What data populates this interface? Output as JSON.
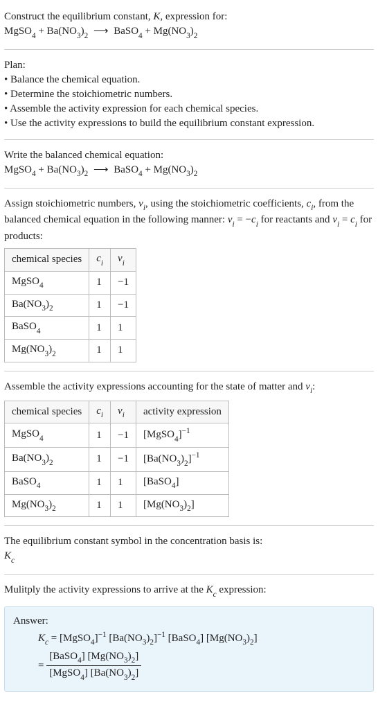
{
  "header": {
    "title_prefix": "Construct the equilibrium constant, ",
    "title_K": "K",
    "title_suffix": ", expression for:"
  },
  "equation": {
    "r1": "MgSO",
    "r1s": "4",
    "plus1": " + ",
    "r2": "Ba(NO",
    "r2s": "3",
    "r2e": ")",
    "r2s2": "2",
    "arrow": " ⟶ ",
    "p1": "BaSO",
    "p1s": "4",
    "plus2": " + ",
    "p2": "Mg(NO",
    "p2s": "3",
    "p2e": ")",
    "p2s2": "2"
  },
  "plan": {
    "heading": "Plan:",
    "b1": "• Balance the chemical equation.",
    "b2": "• Determine the stoichiometric numbers.",
    "b3": "• Assemble the activity expression for each chemical species.",
    "b4": "• Use the activity expressions to build the equilibrium constant expression."
  },
  "balanced_heading": "Write the balanced chemical equation:",
  "stoich": {
    "intro_a": "Assign stoichiometric numbers, ",
    "nu": "ν",
    "nu_i": "i",
    "intro_b": ", using the stoichiometric coefficients, ",
    "c": "c",
    "c_i": "i",
    "intro_c": ", from the balanced chemical equation in the following manner: ",
    "rel1": " = −",
    "intro_d": " for reactants and ",
    "rel2": " = ",
    "intro_e": " for products:",
    "th1": "chemical species",
    "th2": "c",
    "th2i": "i",
    "th3": "ν",
    "th3i": "i",
    "rows": [
      {
        "sp": "MgSO",
        "sps": "4",
        "sp2": "",
        "sps2": "",
        "c": "1",
        "v": "−1"
      },
      {
        "sp": "Ba(NO",
        "sps": "3",
        "sp2": ")",
        "sps2": "2",
        "c": "1",
        "v": "−1"
      },
      {
        "sp": "BaSO",
        "sps": "4",
        "sp2": "",
        "sps2": "",
        "c": "1",
        "v": "1"
      },
      {
        "sp": "Mg(NO",
        "sps": "3",
        "sp2": ")",
        "sps2": "2",
        "c": "1",
        "v": "1"
      }
    ]
  },
  "activity": {
    "heading_a": "Assemble the activity expressions accounting for the state of matter and ",
    "heading_b": ":",
    "th4": "activity expression",
    "rows": [
      {
        "sp": "MgSO",
        "sps": "4",
        "sp2": "",
        "sps2": "",
        "c": "1",
        "v": "−1",
        "act_pre": "[MgSO",
        "act_s": "4",
        "act_mid": "]",
        "act_s2": "",
        "act_exp": "−1"
      },
      {
        "sp": "Ba(NO",
        "sps": "3",
        "sp2": ")",
        "sps2": "2",
        "c": "1",
        "v": "−1",
        "act_pre": "[Ba(NO",
        "act_s": "3",
        "act_mid": ")",
        "act_s2": "2",
        "act_close": "]",
        "act_exp": "−1"
      },
      {
        "sp": "BaSO",
        "sps": "4",
        "sp2": "",
        "sps2": "",
        "c": "1",
        "v": "1",
        "act_pre": "[BaSO",
        "act_s": "4",
        "act_mid": "]",
        "act_s2": "",
        "act_exp": ""
      },
      {
        "sp": "Mg(NO",
        "sps": "3",
        "sp2": ")",
        "sps2": "2",
        "c": "1",
        "v": "1",
        "act_pre": "[Mg(NO",
        "act_s": "3",
        "act_mid": ")",
        "act_s2": "2",
        "act_close": "]",
        "act_exp": ""
      }
    ]
  },
  "symbol": {
    "line1": "The equilibrium constant symbol in the concentration basis is:",
    "Kc": "K",
    "Kc_sub": "c"
  },
  "multiply": {
    "line_a": "Mulitply the activity expressions to arrive at the ",
    "line_b": " expression:"
  },
  "answer": {
    "label": "Answer:",
    "eq": " = ",
    "t1": "[MgSO",
    "t1s": "4",
    "t1c": "]",
    "exp_neg1": "−1",
    "sp": " ",
    "t2": "[Ba(NO",
    "t2s": "3",
    "t2m": ")",
    "t2s2": "2",
    "t2c": "]",
    "t3": "[BaSO",
    "t3s": "4",
    "t3c": "]",
    "t4": "[Mg(NO",
    "t4s": "3",
    "t4m": ")",
    "t4s2": "2",
    "t4c": "]",
    "eq2": "= "
  }
}
